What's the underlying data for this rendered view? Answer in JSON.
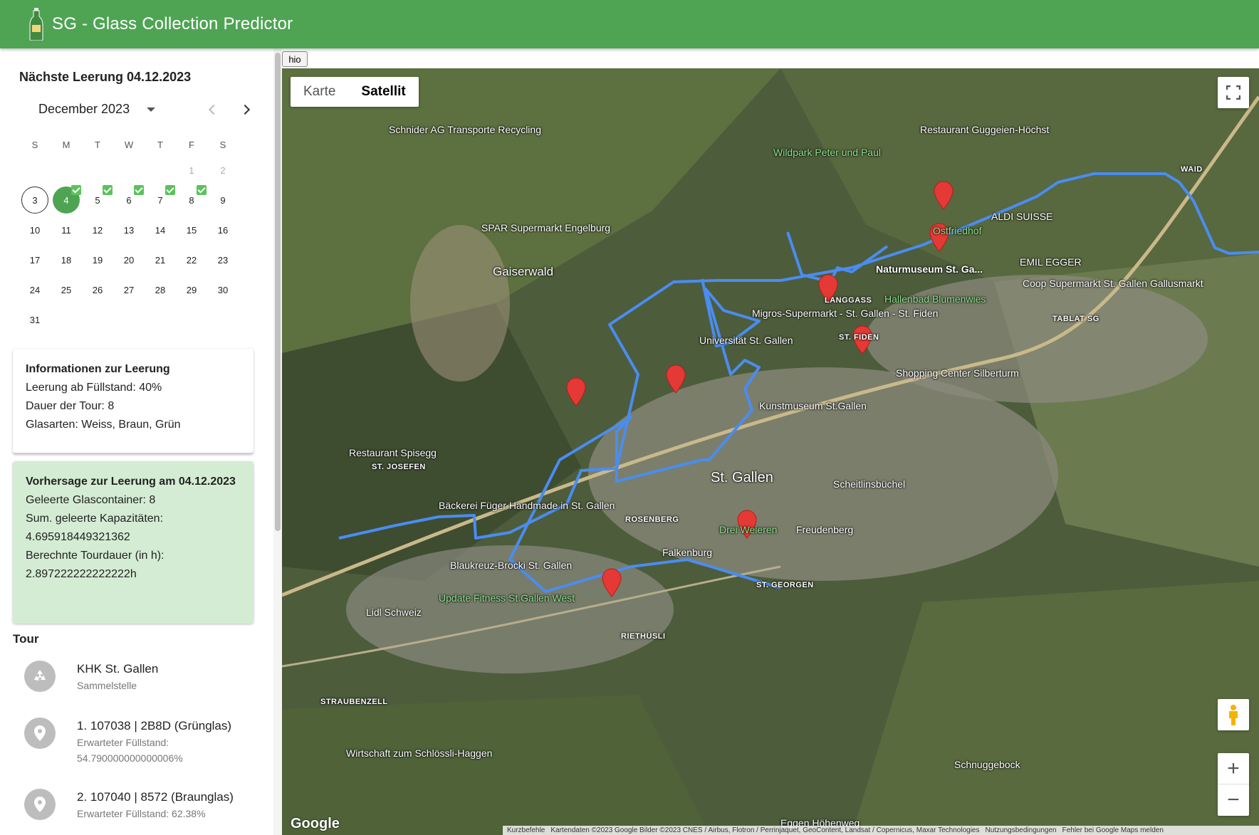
{
  "app": {
    "title": "SG - Glass Collection Predictor"
  },
  "sidebar": {
    "next_collection": "Nächste Leerung 04.12.2023",
    "calendar": {
      "month_label": "December 2023",
      "weekdays": [
        "S",
        "M",
        "T",
        "W",
        "T",
        "F",
        "S"
      ],
      "weeks": [
        [
          "",
          "",
          "",
          "",
          "",
          "1",
          "2"
        ],
        [
          "3",
          "4",
          "5",
          "6",
          "7",
          "8",
          "9"
        ],
        [
          "10",
          "11",
          "12",
          "13",
          "14",
          "15",
          "16"
        ],
        [
          "17",
          "18",
          "19",
          "20",
          "21",
          "22",
          "23"
        ],
        [
          "24",
          "25",
          "26",
          "27",
          "28",
          "29",
          "30"
        ],
        [
          "31",
          "",
          "",
          "",
          "",
          "",
          ""
        ]
      ],
      "today": "3",
      "selected": "4",
      "checked_days": [
        "4",
        "5",
        "6",
        "7",
        "8"
      ]
    },
    "info": {
      "title": "Informationen zur Leerung",
      "fill_level": "Leerung ab Füllstand: 40%",
      "duration": "Dauer der Tour: 8",
      "glass_types": "Glasarten: Weiss, Braun, Grün"
    },
    "prediction": {
      "title": "Vorhersage zur Leerung am 04.12.2023",
      "containers": "Geleerte Glascontainer: 8",
      "capacity_label": "Sum. geleerte Kapazitäten:",
      "capacity_value": "4.695918449321362",
      "duration_label": "Berechnte Tourdauer (in h):",
      "duration_value": "2.897222222222222h"
    },
    "tour": {
      "title": "Tour",
      "items": [
        {
          "primary": "KHK St. Gallen",
          "secondary": "Sammelstelle",
          "icon": "recycle-icon"
        },
        {
          "primary": "1. 107038 | 2B8D (Grünglas)",
          "secondary": "Erwarteter Füllstand: 54.790000000000006%",
          "icon": "location-pin-icon"
        },
        {
          "primary": "2. 107040 | 8572 (Braunglas)",
          "secondary": "Erwarteter Füllstand: 62.38%",
          "icon": "location-pin-icon"
        }
      ]
    }
  },
  "map": {
    "hio_label": "hio",
    "type_map": "Karte",
    "type_satellite": "Satellit",
    "active_type": "Satellit",
    "google_label": "Google",
    "attribution": [
      "Kurzbefehle",
      "Kartendaten ©2023 Google Bilder ©2023 CNES / Airbus, Flotron / Perrinjaquet, GeoContent, Landsat / Copernicus, Maxar Technologies",
      "Nutzungsbedingungen",
      "Fehler bei Google Maps melden"
    ],
    "labels": [
      "Schnider AG Transporte Recycling",
      "Wildpark Peter und Paul",
      "Restaurant Guggeien-Höchst",
      "SPAR Supermarkt Engelburg",
      "Gaiserwald",
      "ALDI SUISSE",
      "Ostfriedhof",
      "Naturmuseum St. Ga...",
      "EMIL EGGER",
      "Coop Supermarkt St. Gallen Gallusmarkt",
      "Hallenbad Blumenwies",
      "LANGGASS",
      "Migros-Supermarkt - St. Gallen - St. Fiden",
      "Universität St. Gallen",
      "ST. FIDEN",
      "Shopping Center Silberturm",
      "TABLAT SG",
      "Kunstmuseum St.Gallen",
      "Restaurant Spisegg",
      "ST. JOSEFEN",
      "St. Gallen",
      "Scheitlinsbüchel",
      "Bäckerei Füger Handmade in St. Gallen",
      "ROSENBERG",
      "Drei Weieren",
      "Freudenberg",
      "Falkenburg",
      "Blaukreuz-Brocki St. Gallen",
      "Update Fitness St.Gallen West",
      "ST. GEORGEN",
      "Lidl Schweiz",
      "RIETHÜSLI",
      "STRAUBENZELL",
      "Wirtschaft zum Schlössli-Haggen",
      "Schnuggebock",
      "Eggen Höhenweg",
      "WAID"
    ]
  },
  "colors": {
    "brand": "#4ea453",
    "route": "#4a8df0",
    "marker": "#e53935",
    "prediction_bg": "#d4ecd4"
  }
}
